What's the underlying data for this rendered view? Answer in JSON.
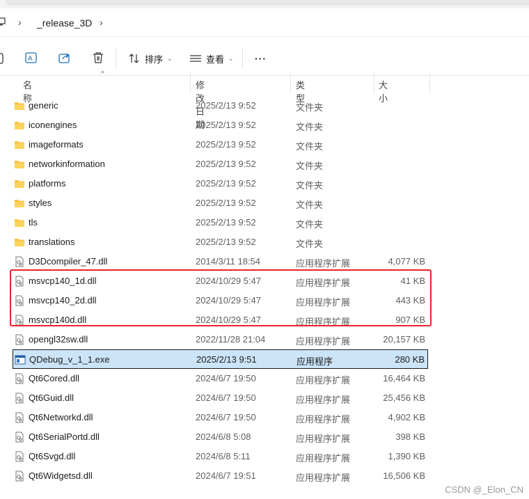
{
  "address": {
    "crumb": "_release_3D"
  },
  "toolbar": {
    "sort_label": "排序",
    "view_label": "查看",
    "more_label": "···"
  },
  "columns": {
    "name": "名称",
    "date": "修改日期",
    "type": "类型",
    "size": "大小"
  },
  "rows": [
    {
      "name": "generic",
      "date": "2025/2/13 9:52",
      "type": "文件夹",
      "size": "",
      "kind": "folder"
    },
    {
      "name": "iconengines",
      "date": "2025/2/13 9:52",
      "type": "文件夹",
      "size": "",
      "kind": "folder"
    },
    {
      "name": "imageformats",
      "date": "2025/2/13 9:52",
      "type": "文件夹",
      "size": "",
      "kind": "folder"
    },
    {
      "name": "networkinformation",
      "date": "2025/2/13 9:52",
      "type": "文件夹",
      "size": "",
      "kind": "folder"
    },
    {
      "name": "platforms",
      "date": "2025/2/13 9:52",
      "type": "文件夹",
      "size": "",
      "kind": "folder"
    },
    {
      "name": "styles",
      "date": "2025/2/13 9:52",
      "type": "文件夹",
      "size": "",
      "kind": "folder"
    },
    {
      "name": "tls",
      "date": "2025/2/13 9:52",
      "type": "文件夹",
      "size": "",
      "kind": "folder"
    },
    {
      "name": "translations",
      "date": "2025/2/13 9:52",
      "type": "文件夹",
      "size": "",
      "kind": "folder"
    },
    {
      "name": "D3Dcompiler_47.dll",
      "date": "2014/3/11 18:54",
      "type": "应用程序扩展",
      "size": "4,077 KB",
      "kind": "dll"
    },
    {
      "name": "msvcp140_1d.dll",
      "date": "2024/10/29 5:47",
      "type": "应用程序扩展",
      "size": "41 KB",
      "kind": "dll"
    },
    {
      "name": "msvcp140_2d.dll",
      "date": "2024/10/29 5:47",
      "type": "应用程序扩展",
      "size": "443 KB",
      "kind": "dll"
    },
    {
      "name": "msvcp140d.dll",
      "date": "2024/10/29 5:47",
      "type": "应用程序扩展",
      "size": "907 KB",
      "kind": "dll"
    },
    {
      "name": "opengl32sw.dll",
      "date": "2022/11/28 21:04",
      "type": "应用程序扩展",
      "size": "20,157 KB",
      "kind": "dll"
    },
    {
      "name": "QDebug_v_1_1.exe",
      "date": "2025/2/13 9:51",
      "type": "应用程序",
      "size": "280 KB",
      "kind": "exe",
      "selected": true
    },
    {
      "name": "Qt6Cored.dll",
      "date": "2024/6/7 19:50",
      "type": "应用程序扩展",
      "size": "16,464 KB",
      "kind": "dll"
    },
    {
      "name": "Qt6Guid.dll",
      "date": "2024/6/7 19:50",
      "type": "应用程序扩展",
      "size": "25,456 KB",
      "kind": "dll"
    },
    {
      "name": "Qt6Networkd.dll",
      "date": "2024/6/7 19:50",
      "type": "应用程序扩展",
      "size": "4,902 KB",
      "kind": "dll"
    },
    {
      "name": "Qt6SerialPortd.dll",
      "date": "2024/6/8 5:08",
      "type": "应用程序扩展",
      "size": "398 KB",
      "kind": "dll"
    },
    {
      "name": "Qt6Svgd.dll",
      "date": "2024/6/8 5:11",
      "type": "应用程序扩展",
      "size": "1,390 KB",
      "kind": "dll"
    },
    {
      "name": "Qt6Widgetsd.dll",
      "date": "2024/6/7 19:51",
      "type": "应用程序扩展",
      "size": "16,506 KB",
      "kind": "dll"
    }
  ],
  "watermark": "CSDN @_Elon_CN",
  "colors": {
    "folder": "#f7c244",
    "selected_bg": "#cce4f7",
    "highlight": "#e8232a"
  }
}
